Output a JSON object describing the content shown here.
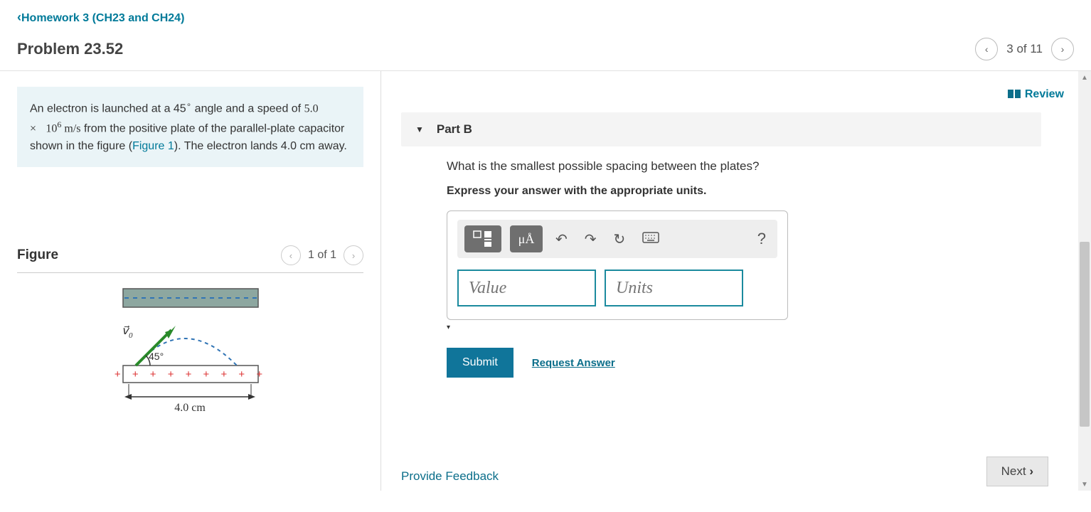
{
  "breadcrumb": "Homework 3 (CH23 and CH24)",
  "problem_title": "Problem 23.52",
  "nav": {
    "position": "3 of 11"
  },
  "description": {
    "line1_a": "An electron is launched at a 45",
    "deg": "∘",
    "line1_b": " angle and a speed of ",
    "speed_base": "5.0 ×",
    "speed_pow_base": "10",
    "speed_exp": "6",
    "speed_units": " m/s",
    "line2": " from the positive plate of the parallel-plate capacitor shown in the figure (",
    "fig_link": "Figure 1",
    "line3": "). The electron lands 4.0 cm away."
  },
  "figure": {
    "title": "Figure",
    "count": "1 of 1",
    "v_label": "v⃗",
    "v_sub": "0",
    "angle": "45°",
    "distance": "4.0 cm"
  },
  "review_label": "Review",
  "part": {
    "label": "Part B",
    "question": "What is the smallest possible spacing between the plates?",
    "instruction": "Express your answer with the appropriate units."
  },
  "toolbar": {
    "units_btn": "μÅ",
    "help": "?"
  },
  "inputs": {
    "value_placeholder": "Value",
    "units_placeholder": "Units"
  },
  "actions": {
    "submit": "Submit",
    "request": "Request Answer",
    "feedback": "Provide Feedback",
    "next": "Next "
  }
}
